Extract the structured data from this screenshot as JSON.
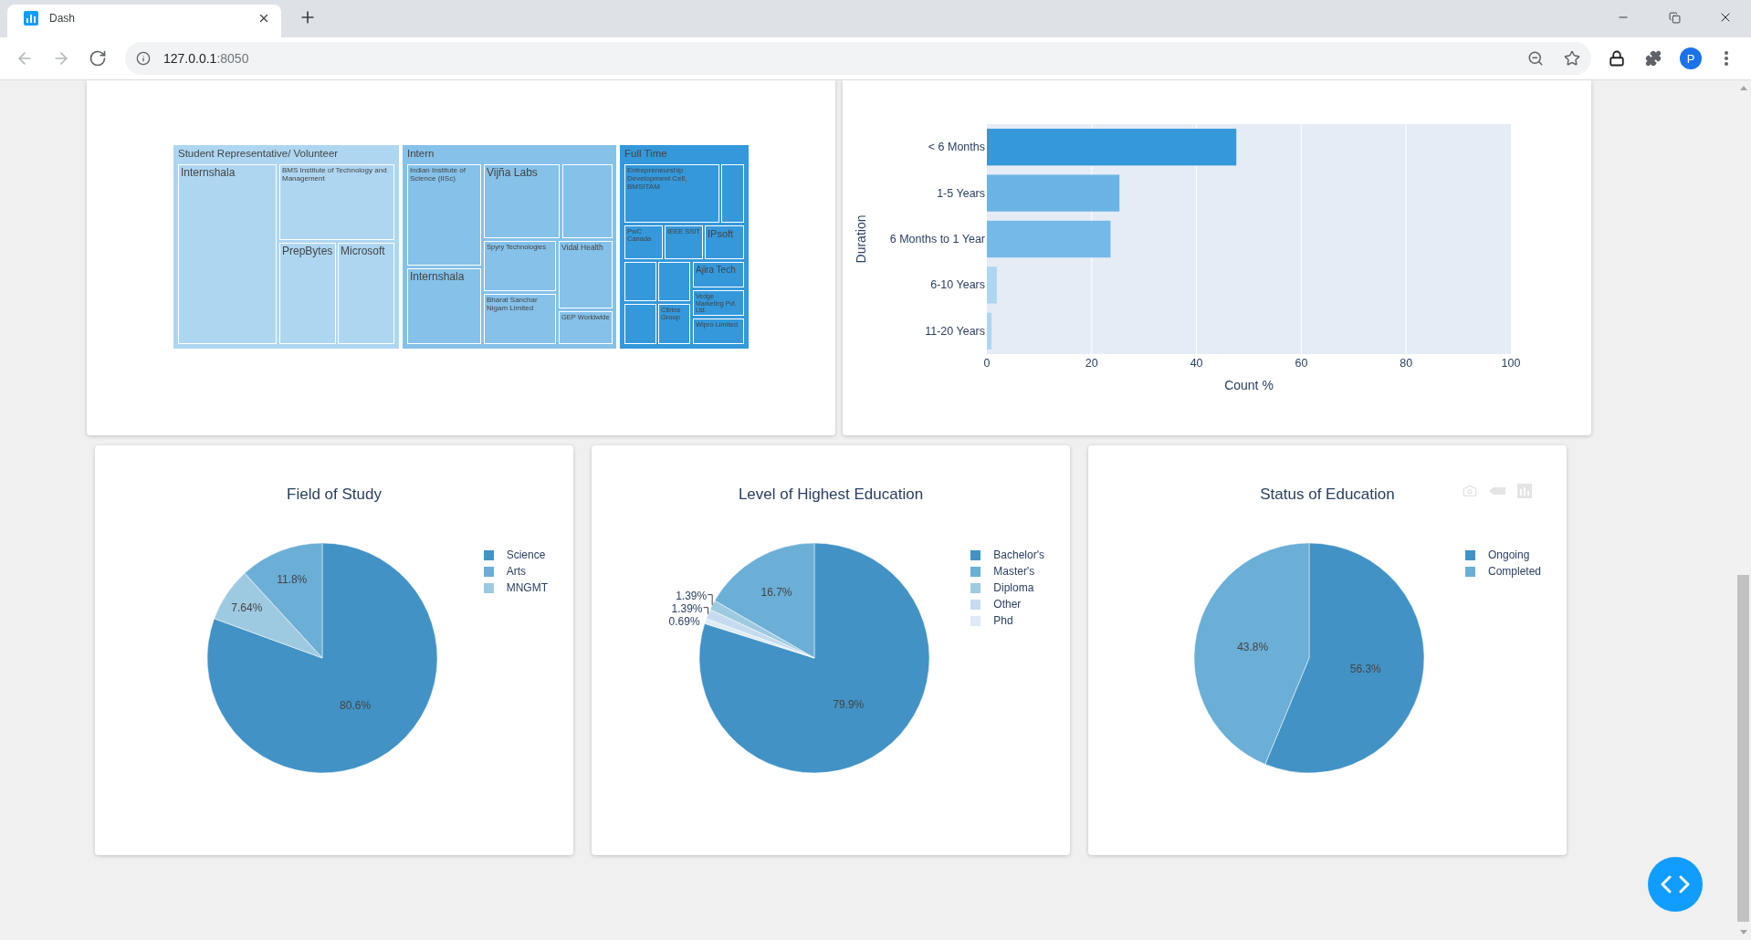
{
  "browser": {
    "tabs": [
      {
        "title": "Dash",
        "selected": true
      }
    ],
    "nav": [
      {
        "kind": "back",
        "disabled": true
      },
      {
        "kind": "forward",
        "disabled": true
      },
      {
        "kind": "reload",
        "disabled": false
      }
    ],
    "address": {
      "host": "127.0.0.1",
      "port": ":8050"
    },
    "profile_initial": "P"
  },
  "treemap": {
    "groups": [
      {
        "label": "Student Representative/ Volunteer",
        "color": "#aed6f1",
        "tiles": [
          "Internshala",
          "BMS Institute of Technology and Management",
          "PrepBytes",
          "Microsoft"
        ]
      },
      {
        "label": "Intern",
        "color": "#85c1e9",
        "tiles": [
          "Indian Institute of Science (IISc)",
          "Internshala",
          "Vijña Labs",
          "Spyry Technologies",
          "Bharat Sanchar Nigam Limited",
          "Vidal Health",
          "GEP Worldwide"
        ]
      },
      {
        "label": "Full Time",
        "color": "#3498db",
        "tiles": [
          "Entrepreneurship Development Cell, BMSITAM",
          "PwC Canada",
          "IEEE SSIT",
          "IPsoft",
          "Ajira Tech",
          "Vedge Marketing Pvt. Ltd.",
          "Citrine Group",
          "Wipro Limited"
        ]
      }
    ]
  },
  "duration_chart": {
    "chart_data": {
      "type": "bar",
      "orientation": "h",
      "xlabel": "Count %",
      "ylabel": "Duration",
      "categories": [
        "< 6 Months",
        "1-5 Years",
        "6 Months to 1 Year",
        "6-10 Years",
        "11-20 Years"
      ],
      "series": [
        {
          "values": [
            47.6,
            25.3,
            23.6,
            1.9,
            0.9
          ],
          "colors": [
            "#3498db",
            "#6cb3e5",
            "#75b9e8",
            "#aed6f1",
            "#aed6f1"
          ]
        }
      ],
      "xlim": [
        0,
        100
      ],
      "xticks": [
        0,
        20,
        40,
        60,
        80,
        100
      ],
      "grid": true
    }
  },
  "education_charts": [
    {
      "toolbar_visible": false,
      "chart_data": {
        "type": "pie",
        "title": "Field of Study",
        "categories": [
          "Science",
          "Arts",
          "MNGMT"
        ],
        "values": [
          80.6,
          11.8,
          7.64
        ],
        "colors": [
          "#4292c6",
          "#6baed6",
          "#9ecae1"
        ],
        "value_labels": [
          "80.6%",
          "11.8%",
          "7.64%"
        ],
        "legend": "right"
      }
    },
    {
      "toolbar_visible": false,
      "chart_data": {
        "type": "pie",
        "title": "Level of Highest Education",
        "categories": [
          "Bachelor's",
          "Master's",
          "Diploma",
          "Other",
          "Phd"
        ],
        "values": [
          79.9,
          16.7,
          1.39,
          1.39,
          0.69
        ],
        "colors": [
          "#4292c6",
          "#6baed6",
          "#9ecae1",
          "#c6dbef",
          "#deebf7"
        ],
        "value_labels": [
          "79.9%",
          "16.7%",
          "1.39%",
          "1.39%",
          "0.69%"
        ],
        "legend": "right"
      }
    },
    {
      "toolbar_visible": true,
      "chart_data": {
        "type": "pie",
        "title": "Status of Education",
        "categories": [
          "Ongoing",
          "Completed"
        ],
        "values": [
          56.3,
          43.8
        ],
        "colors": [
          "#4292c6",
          "#6baed6"
        ],
        "value_labels": [
          "56.3%",
          "43.8%"
        ],
        "legend": "right"
      }
    }
  ]
}
